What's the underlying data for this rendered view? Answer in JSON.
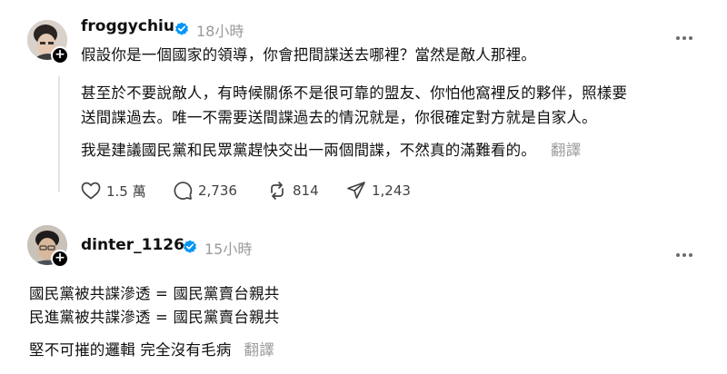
{
  "post1": {
    "username": "froggychiu",
    "time": "18小時",
    "paragraph1": "假設你是一個國家的領導，你會把間諜送去哪裡？當然是敵人那裡。",
    "paragraph2_line1": "甚至於不要說敵人，有時候關係不是很可靠的盟友、你怕他窩裡反的夥伴，照樣要",
    "paragraph2_line2": "送間諜過去。唯一不需要送間諜過去的情況就是，你很確定對方就是自家人。",
    "paragraph3": "我是建議國民黨和民眾黨趕快交出一兩個間諜，不然真的滿難看的。",
    "translate": "翻譯",
    "actions": {
      "likes": "1.5 萬",
      "comments": "2,736",
      "reposts": "814",
      "shares": "1,243"
    }
  },
  "post2": {
    "username": "dinter_1126",
    "time": "15小時",
    "line1": "國民黨被共諜滲透 = 國民黨賣台親共",
    "line2": "民進黨被共諜滲透 = 國民黨賣台親共",
    "line3": "堅不可摧的邏輯 完全沒有毛病",
    "translate": "翻譯"
  },
  "colors": {
    "verified": "#0095f6",
    "muted": "#9a9a9a",
    "text": "#101010"
  }
}
